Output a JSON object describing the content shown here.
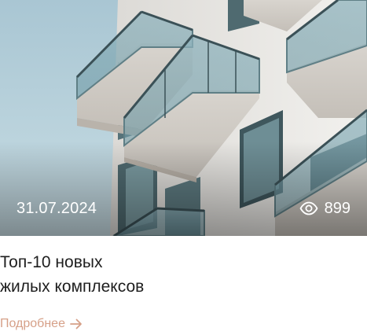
{
  "card": {
    "image": {
      "alt_subject": "building-balconies-photo"
    },
    "date": "31.07.2024",
    "views": {
      "icon": "eye-icon",
      "count": "899"
    },
    "title_lines": [
      "Топ-10 новых",
      "жилых комплексов"
    ],
    "more_link": {
      "label": "Подробнее",
      "icon": "arrow-right-icon"
    }
  },
  "colors": {
    "accent": "#d6a088",
    "title": "#1e1e1e",
    "overlay_text": "#ffffff"
  }
}
